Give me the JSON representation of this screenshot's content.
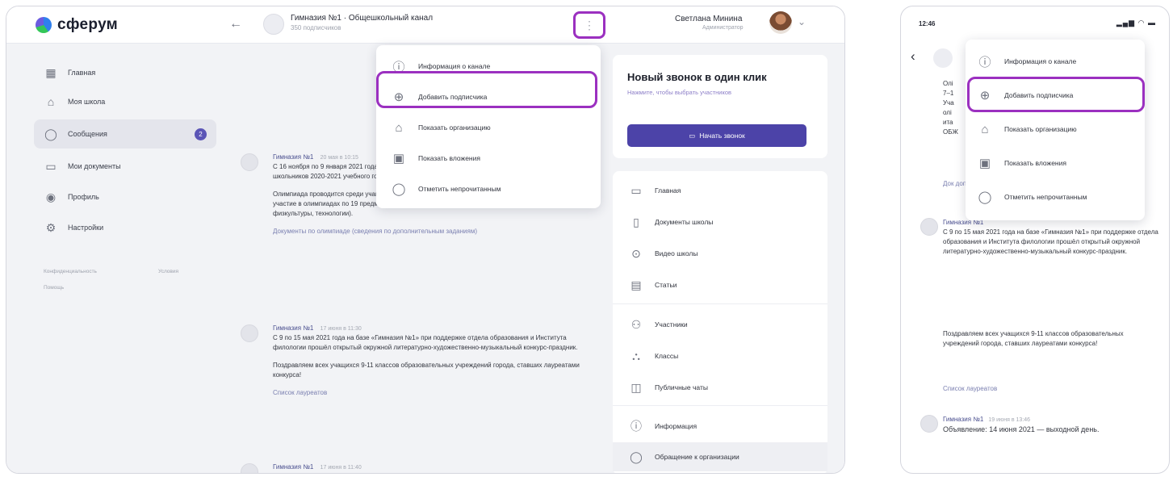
{
  "desktop": {
    "logo_text": "сферум",
    "header": {
      "back_icon": "arrow-left-icon",
      "chat_title": "Гимназия №1 · Общешкольный канал",
      "chat_subtitle": "350 подписчиков",
      "menu_icon": "more-vertical-icon",
      "user_name": "Светлана Минина",
      "user_role": "Администратор"
    },
    "sidebar": {
      "items": [
        {
          "icon": "home-icon",
          "label": "Главная"
        },
        {
          "icon": "school-icon",
          "label": "Моя школа"
        },
        {
          "icon": "chat-icon",
          "label": "Сообщения",
          "badge": "2"
        },
        {
          "icon": "document-icon",
          "label": "Мои документы"
        },
        {
          "icon": "profile-icon",
          "label": "Профиль"
        },
        {
          "icon": "settings-icon",
          "label": "Настройки"
        }
      ],
      "footer_links": [
        "Конфиденциальность",
        "Условия",
        "Помощь"
      ]
    },
    "menu": {
      "items": [
        {
          "icon": "info-icon",
          "label": "Информация о канале"
        },
        {
          "icon": "add-icon",
          "label": "Добавить подписчика"
        },
        {
          "icon": "organization-icon",
          "label": "Показать организацию"
        },
        {
          "icon": "image-icon",
          "label": "Показать вложения"
        },
        {
          "icon": "message-icon",
          "label": "Отметить непрочитанным"
        }
      ]
    },
    "messages": [
      {
        "author": "Гимназия №1",
        "time": "20 мая в 10:15",
        "paragraphs": [
          "С 16 ноября по 9 января 2021 года проходит муниципальный этап всероссийской олимпиады школьников 2020-2021 учебного года.",
          "Олимпиада проводится среди учащихся 7–11-х классов по 24 предметам. Ученики гимназии принимают участие в олимпиадах по 19 предметам (кроме итальянского языка, испанского языка, ОБЖ, физкультуры, технологии)."
        ],
        "link": "Документы по олимпиаде (сведения по дополнительным заданиям)"
      },
      {
        "author": "Гимназия №1",
        "time": "17 июня в 11:30",
        "paragraphs": [
          "С 9 по 15 мая 2021 года на базе «Гимназия №1» при поддержке отдела образования и Института филологии прошёл открытый окружной литературно-художественно-музыкальный конкурс-праздник.",
          "Поздравляем всех учащихся 9-11 классов образовательных учреждений города, ставших лауреатами конкурса!"
        ],
        "link": "Список лауреатов"
      },
      {
        "author": "Гимназия №1",
        "time": "17 июня в 11:40",
        "paragraphs": [],
        "link": ""
      }
    ],
    "call_card": {
      "title": "Новый звонок в один клик",
      "subtitle": "Нажмите, чтобы выбрать участников",
      "button_icon": "video-icon",
      "button_label": "Начать звонок"
    },
    "right_links": [
      {
        "icon": "main-icon",
        "label": "Главная"
      },
      {
        "icon": "docs-icon",
        "label": "Документы школы"
      },
      {
        "icon": "video-icon",
        "label": "Видео школы"
      },
      {
        "icon": "article-icon",
        "label": "Статьи"
      },
      {
        "icon": "users-icon",
        "label": "Участники"
      },
      {
        "icon": "classes-icon",
        "label": "Классы"
      },
      {
        "icon": "public-chat-icon",
        "label": "Публичные чаты"
      },
      {
        "icon": "info-icon",
        "label": "Информация"
      },
      {
        "icon": "contact-icon",
        "label": "Обращение к организации"
      }
    ]
  },
  "mobile": {
    "status_time": "12:46",
    "status_icons": "signal wifi battery",
    "menu": {
      "items": [
        {
          "icon": "info-icon",
          "label": "Информация о канале"
        },
        {
          "icon": "add-icon",
          "label": "Добавить подписчика"
        },
        {
          "icon": "organization-icon",
          "label": "Показать организацию"
        },
        {
          "icon": "image-icon",
          "label": "Показать вложения"
        },
        {
          "icon": "message-icon",
          "label": "Отметить непрочитанным"
        }
      ]
    },
    "feed": {
      "partial_lines": [
        "Олі",
        "7–1",
        "Уча",
        "олі",
        "ита",
        "ОБЖ"
      ],
      "partial_link": "Док доп",
      "msg1_author": "Гимназия №1",
      "msg1_text": "С 9 по 15 мая 2021 года на базе «Гимназия №1» при поддержке отдела образования и Института филологии прошёл открытый окружной литературно-художественно-музыкальный конкурс-праздник.",
      "msg1_text2": "Поздравляем всех учащихся 9-11 классов образовательных учреждений города, ставших лауреатами конкурса!",
      "msg1_link": "Список лауреатов",
      "msg2_author": "Гимназия №1",
      "msg2_time": "19 июня в 13:46",
      "msg2_text": "Объявление: 14 июня 2021 — выходной день."
    }
  }
}
